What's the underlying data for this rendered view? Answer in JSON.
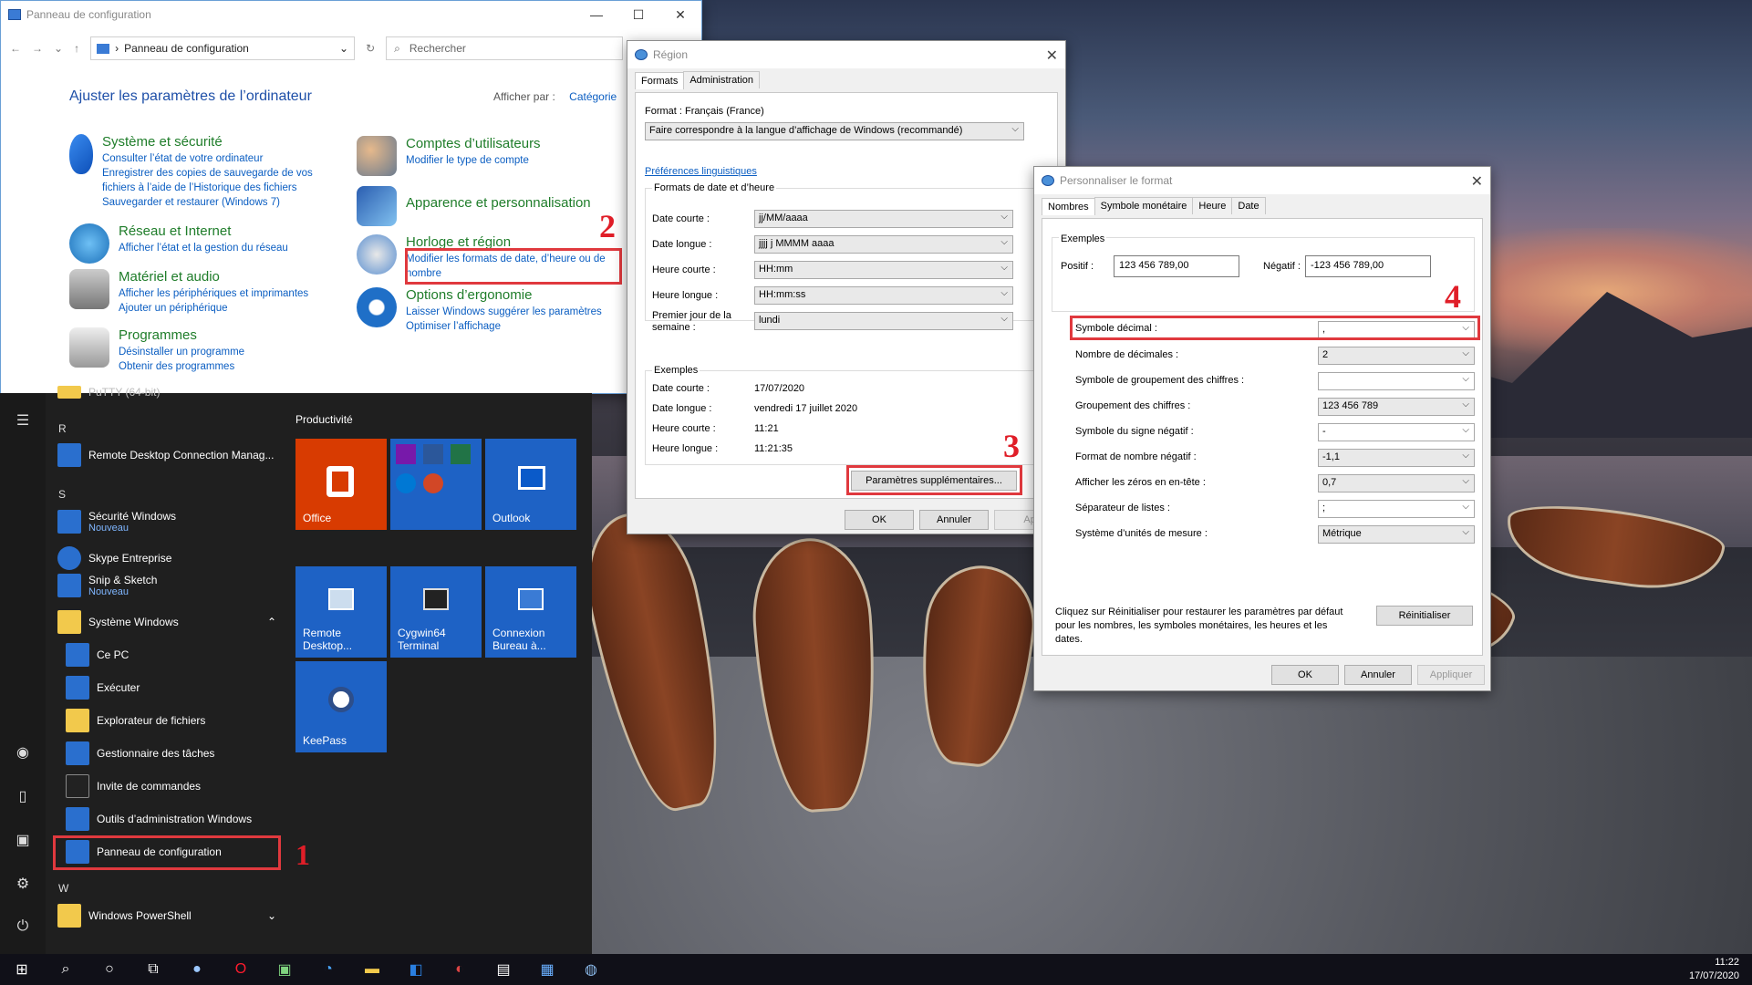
{
  "control_panel": {
    "title": "Panneau de configuration",
    "address": "Panneau de configuration",
    "search_placeholder": "Rechercher",
    "heading": "Ajuster les paramètres de l’ordinateur",
    "view_by_label": "Afficher par :",
    "view_by_value": "Catégorie",
    "categories": [
      {
        "title": "Système et sécurité",
        "links": [
          "Consulter l’état de votre ordinateur",
          "Enregistrer des copies de sauvegarde de vos fichiers à l’aide de l’Historique des fichiers",
          "Sauvegarder et restaurer (Windows 7)"
        ]
      },
      {
        "title": "Réseau et Internet",
        "links": [
          "Afficher l’état et la gestion du réseau"
        ]
      },
      {
        "title": "Matériel et audio",
        "links": [
          "Afficher les périphériques et imprimantes",
          "Ajouter un périphérique"
        ]
      },
      {
        "title": "Programmes",
        "links": [
          "Désinstaller un programme",
          "Obtenir des programmes"
        ]
      },
      {
        "title": "Comptes d’utilisateurs",
        "links": [
          "Modifier le type de compte"
        ]
      },
      {
        "title": "Apparence et personnalisation",
        "links": []
      },
      {
        "title": "Horloge et région",
        "links": [
          "Modifier les formats de date, d’heure ou de nombre"
        ]
      },
      {
        "title": "Options d’ergonomie",
        "links": [
          "Laisser Windows suggérer les paramètres",
          "Optimiser l’affichage"
        ]
      }
    ]
  },
  "annotations": {
    "n1": "1",
    "n2": "2",
    "n3": "3",
    "n4": "4"
  },
  "region": {
    "title": "Région",
    "tabs": [
      "Formats",
      "Administration"
    ],
    "format_label": "Format : Français (France)",
    "format_value": "Faire correspondre à la langue d’affichage de Windows (recommandé)",
    "lang_prefs": "Préférences linguistiques",
    "date_time_group": "Formats de date et d’heure",
    "fields": [
      {
        "label": "Date courte :",
        "value": "jj/MM/aaaa"
      },
      {
        "label": "Date longue :",
        "value": "jjjj j MMMM aaaa"
      },
      {
        "label": "Heure courte :",
        "value": "HH:mm"
      },
      {
        "label": "Heure longue :",
        "value": "HH:mm:ss"
      },
      {
        "label": "Premier jour de la semaine :",
        "value": "lundi"
      }
    ],
    "examples_group": "Exemples",
    "examples": [
      {
        "label": "Date courte :",
        "value": "17/07/2020"
      },
      {
        "label": "Date longue :",
        "value": "vendredi 17 juillet 2020"
      },
      {
        "label": "Heure courte :",
        "value": "11:21"
      },
      {
        "label": "Heure longue :",
        "value": "11:21:35"
      }
    ],
    "more_settings": "Paramètres supplémentaires...",
    "ok": "OK",
    "cancel": "Annuler",
    "apply": "Appliq"
  },
  "format": {
    "title": "Personnaliser le format",
    "tabs": [
      "Nombres",
      "Symbole monétaire",
      "Heure",
      "Date"
    ],
    "examples_label": "Exemples",
    "positive_label": "Positif :",
    "positive_value": "123 456 789,00",
    "negative_label": "Négatif :",
    "negative_value": "-123 456 789,00",
    "rows": [
      {
        "label": "Symbole décimal :",
        "value": ","
      },
      {
        "label": "Nombre de décimales :",
        "value": "2"
      },
      {
        "label": "Symbole de groupement des chiffres :",
        "value": ""
      },
      {
        "label": "Groupement des chiffres :",
        "value": "123 456 789"
      },
      {
        "label": "Symbole du signe négatif :",
        "value": "-"
      },
      {
        "label": "Format de nombre négatif :",
        "value": "-1,1"
      },
      {
        "label": "Afficher les zéros en en-tête :",
        "value": "0,7"
      },
      {
        "label": "Séparateur de listes :",
        "value": ";"
      },
      {
        "label": "Système d’unités de mesure :",
        "value": "Métrique"
      }
    ],
    "reset_text": "Cliquez sur Réinitialiser pour restaurer les paramètres par défaut pour les nombres, les symboles monétaires, les heures et les dates.",
    "reset": "Réinitialiser",
    "ok": "OK",
    "cancel": "Annuler",
    "apply": "Appliquer"
  },
  "start": {
    "top_item": "PuTTY (64-bit)",
    "letters": [
      "R",
      "S",
      "W"
    ],
    "apps": [
      {
        "label": "Remote Desktop Connection Manag...",
        "sub": ""
      },
      {
        "label": "Sécurité Windows",
        "sub": "Nouveau"
      },
      {
        "label": "Skype Entreprise",
        "sub": ""
      },
      {
        "label": "Snip & Sketch",
        "sub": "Nouveau"
      },
      {
        "label": "Système Windows",
        "sub": ""
      },
      {
        "label": "Ce PC",
        "sub": ""
      },
      {
        "label": "Exécuter",
        "sub": ""
      },
      {
        "label": "Explorateur de fichiers",
        "sub": ""
      },
      {
        "label": "Gestionnaire des tâches",
        "sub": ""
      },
      {
        "label": "Invite de commandes",
        "sub": ""
      },
      {
        "label": "Outils d’administration Windows",
        "sub": ""
      },
      {
        "label": "Panneau de configuration",
        "sub": ""
      },
      {
        "label": "Windows PowerShell",
        "sub": ""
      }
    ],
    "tiles_header": "Productivité",
    "tiles": [
      "Office",
      "Outlook",
      "Remote Desktop...",
      "Cygwin64 Terminal",
      "Connexion Bureau à...",
      "KeePass"
    ]
  },
  "taskbar": {
    "time": "11:22",
    "date": "17/07/2020"
  }
}
